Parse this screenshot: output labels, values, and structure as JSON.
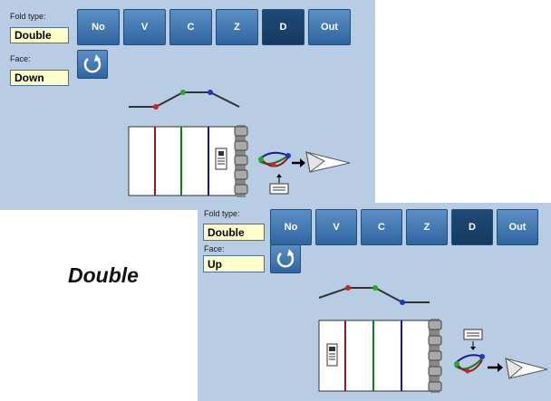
{
  "caption": "Double",
  "panels": [
    {
      "fold_type_label": "Fold type:",
      "fold_type_value": "Double",
      "face_label": "Face:",
      "face_value": "Down",
      "buttons": [
        "No",
        "V",
        "C",
        "Z",
        "D",
        "Out"
      ],
      "selected_button": "D",
      "rotate_icon": "rotate-icon"
    },
    {
      "fold_type_label": "Fold type:",
      "fold_type_value": "Double",
      "face_label": "Face:",
      "face_value": "Up",
      "buttons": [
        "No",
        "V",
        "C",
        "Z",
        "D",
        "Out"
      ],
      "selected_button": "D",
      "rotate_icon": "rotate-icon"
    }
  ],
  "colors": {
    "panel_bg": "#b8cce4",
    "button": "#2f65a0",
    "button_selected": "#163a61",
    "value_box": "#ffffcc",
    "fold_red": "#8b1a1a",
    "fold_green": "#1a7a1a",
    "fold_blue": "#1a1a8b"
  }
}
